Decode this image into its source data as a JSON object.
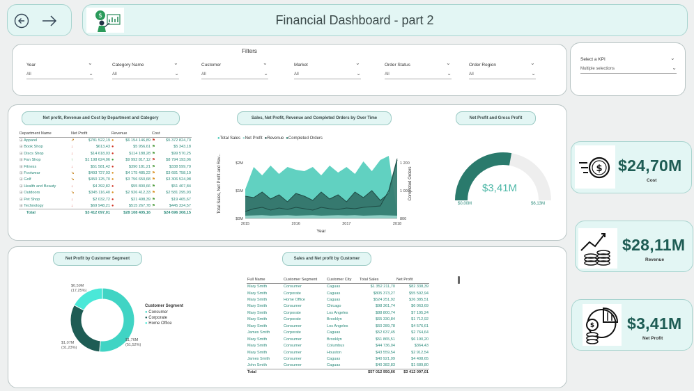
{
  "header": {
    "title": "Financial Dashboard - part 2",
    "back_icon": "arrow-left-icon",
    "forward_icon": "arrow-right-icon",
    "logo_icon": "finance-person-icon"
  },
  "filters": {
    "title": "Filters",
    "items": [
      {
        "label": "Year",
        "value": "All"
      },
      {
        "label": "Category Name",
        "value": "All"
      },
      {
        "label": "Customer",
        "value": "All"
      },
      {
        "label": "Market",
        "value": "All"
      },
      {
        "label": "Order Status",
        "value": "All"
      },
      {
        "label": "Order Region",
        "value": "All"
      }
    ]
  },
  "kpi_selector": {
    "label": "Select a KPI",
    "value": "Multiple selections"
  },
  "dept_table": {
    "title": "Net profit, Revenue and Cost by Department and Category",
    "columns": [
      "Department Name",
      "Net Profit",
      "Revenue",
      "Cost"
    ],
    "rows": [
      {
        "name": "Apparel",
        "net": "$781 522,19",
        "rev": "$6 154 146,89",
        "cost": "$5 372 824,70",
        "ni": "↗",
        "nc": "#c98a2a",
        "ri": "●",
        "rc": "#d89020",
        "ci": "⚑",
        "cc": "#c83a2a"
      },
      {
        "name": "Book Shop",
        "net": "$613,43",
        "rev": "$5 956,61",
        "cost": "$5 343,18",
        "ni": "↓",
        "nc": "#d03020",
        "ri": "●",
        "rc": "#d03020",
        "ci": "⚑",
        "cc": "#4a9a3a"
      },
      {
        "name": "Discs Shop",
        "net": "$14 618,03",
        "rev": "$114 188,28",
        "cost": "$99 570,25",
        "ni": "↓",
        "nc": "#d03020",
        "ri": "●",
        "rc": "#d03020",
        "ci": "⚑",
        "cc": "#4a9a3a"
      },
      {
        "name": "Fan Shop",
        "net": "$1 198 624,06",
        "rev": "$9 992 817,12",
        "cost": "$8 794 193,06",
        "ni": "↑",
        "nc": "#3a9a3a",
        "ri": "●",
        "rc": "#3a9a3a",
        "ci": "⚑",
        "cc": "#c83a2a"
      },
      {
        "name": "Fitness",
        "net": "$51 581,42",
        "rev": "$390 181,21",
        "cost": "$338 599,79",
        "ni": "↓",
        "nc": "#d03020",
        "ri": "●",
        "rc": "#d03020",
        "ci": "⚑",
        "cc": "#4a9a3a"
      },
      {
        "name": "Footwear",
        "net": "$493 727,03",
        "rev": "$4 175 485,22",
        "cost": "$3 681 758,19",
        "ni": "↘",
        "nc": "#c98a2a",
        "ri": "●",
        "rc": "#d89020",
        "ci": "⚑",
        "cc": "#d89020"
      },
      {
        "name": "Golf",
        "net": "$450 125,70",
        "rev": "$3 756 650,68",
        "cost": "$3 306 524,98",
        "ni": "↘",
        "nc": "#c98a2a",
        "ri": "●",
        "rc": "#d89020",
        "ci": "⚑",
        "cc": "#d89020"
      },
      {
        "name": "Health and Beauty",
        "net": "$4 392,82",
        "rev": "$55 800,66",
        "cost": "$51 407,84",
        "ni": "↓",
        "nc": "#d03020",
        "ri": "●",
        "rc": "#d03020",
        "ci": "⚑",
        "cc": "#4a9a3a"
      },
      {
        "name": "Outdoors",
        "net": "$345 116,40",
        "rev": "$2 926 412,33",
        "cost": "$2 581 295,93",
        "ni": "↘",
        "nc": "#c98a2a",
        "ri": "●",
        "rc": "#d89020",
        "ci": "⚑",
        "cc": "#d89020"
      },
      {
        "name": "Pet Shop",
        "net": "$2 032,72",
        "rev": "$21 498,39",
        "cost": "$19 465,67",
        "ni": "↓",
        "nc": "#d03020",
        "ri": "●",
        "rc": "#d03020",
        "ci": "⚑",
        "cc": "#4a9a3a"
      },
      {
        "name": "Technology",
        "net": "$69 948,21",
        "rev": "$515 267,78",
        "cost": "$445 324,57",
        "ni": "↓",
        "nc": "#d03020",
        "ri": "●",
        "rc": "#d03020",
        "ci": "⚑",
        "cc": "#4a9a3a"
      }
    ],
    "total": {
      "name": "Total",
      "net": "$3 412 097,01",
      "rev": "$28 108 405,16",
      "cost": "$24 696 308,15"
    }
  },
  "line_chart": {
    "title": "Sales, Net Profit, Revenue and Completed Orders by Over Time",
    "legend": [
      "Total Sales",
      "Net Profit",
      "Revenue",
      "Completed Orders"
    ],
    "legend_colors": [
      "#45c9b6",
      "#9ad8cf",
      "#1e4a44",
      "#2f7a6c"
    ],
    "xlabel": "Year",
    "ylabel": "Total Sales, Net Profit and Rev...",
    "y2label": "Completed Orders",
    "y_ticks": [
      "$2M",
      "$1M",
      "$0M"
    ],
    "y2_ticks": [
      "1 200",
      "1 000",
      "800"
    ],
    "x_ticks": [
      "2015",
      "2016",
      "2017",
      "2018"
    ]
  },
  "chart_data": [
    {
      "type": "area",
      "title": "Sales, Net Profit, Revenue and Completed Orders by Over Time",
      "xlabel": "Year",
      "ylabel": "Total Sales, Net Profit and Rev...",
      "x": [
        "2015-01",
        "2015-03",
        "2015-05",
        "2015-07",
        "2015-09",
        "2015-11",
        "2016-01",
        "2016-03",
        "2016-05",
        "2016-07",
        "2016-09",
        "2016-11",
        "2017-01",
        "2017-03",
        "2017-05",
        "2017-07",
        "2017-09",
        "2017-11",
        "2018-01"
      ],
      "ylim": [
        0,
        2.5
      ],
      "series": [
        {
          "name": "Total Sales",
          "values": [
            1.05,
            1.85,
            1.55,
            1.9,
            1.6,
            1.85,
            1.75,
            1.7,
            1.85,
            1.55,
            1.9,
            1.65,
            1.85,
            1.6,
            2.05,
            1.7,
            2.1,
            2.25,
            0.15
          ]
        },
        {
          "name": "Revenue",
          "values": [
            0.8,
            0.75,
            0.95,
            0.7,
            0.85,
            0.6,
            0.9,
            0.8,
            0.65,
            0.95,
            0.7,
            0.85,
            0.6,
            0.95,
            0.75,
            1.0,
            0.65,
            0.9,
            2.1
          ]
        },
        {
          "name": "Net Profit",
          "values": [
            0.1,
            0.11,
            0.12,
            0.1,
            0.11,
            0.12,
            0.1,
            0.11,
            0.12,
            0.1,
            0.11,
            0.12,
            0.11,
            0.12,
            0.1,
            0.11,
            0.12,
            0.11,
            0.1
          ]
        },
        {
          "name": "Completed Orders",
          "values": [
            850,
            870,
            880,
            860,
            875,
            865,
            880,
            870,
            860,
            880,
            870,
            865,
            875,
            870,
            880,
            885,
            890,
            1000,
            1230
          ]
        }
      ]
    },
    {
      "type": "pie",
      "title": "Net Profit and Gross Profit",
      "values": [
        3.41
      ],
      "max": 6.13,
      "min": 0,
      "labels": [
        "$3,41M",
        "$0,00M",
        "$6,13M"
      ]
    },
    {
      "type": "pie",
      "title": "Net Profit by Customer Segment",
      "categories": [
        "Consumer",
        "Corporate",
        "Home Office"
      ],
      "values": [
        1.76,
        1.07,
        0.59
      ],
      "labels": [
        "$1,76M\n(51,52%)",
        "$1,07M\n(31,23%)",
        "$0,59M\n(17,25%)"
      ],
      "colors": [
        "#40d4c4",
        "#1e5c54",
        "#4ae8d8"
      ]
    }
  ],
  "gauge": {
    "title": "Net Profit and Gross Profit",
    "value": "$3,41M",
    "min": "$0,00M",
    "max": "$6,13M"
  },
  "donut": {
    "title": "Net Profit by Customer Segment",
    "legend_title": "Customer Segment",
    "legend": [
      "Consumer",
      "Corporate",
      "Home Office"
    ],
    "label_consumer": "$1,76M",
    "pct_consumer": "(51,52%)",
    "label_corporate": "$1,07M",
    "pct_corporate": "(31,23%)",
    "label_home": "$0,59M",
    "pct_home": "(17,25%)"
  },
  "cust_table": {
    "title": "Sales and Net profit by Customer",
    "columns": [
      "Full Name",
      "Customer Segment",
      "Customer City",
      "Total Sales",
      "Net Profit"
    ],
    "rows": [
      [
        "Mary Smith",
        "Consumer",
        "Caguas",
        "$1 352 211,70",
        "$82 338,39"
      ],
      [
        "Mary Smith",
        "Corporate",
        "Caguas",
        "$805 373,27",
        "$55 592,94"
      ],
      [
        "Mary Smith",
        "Home Office",
        "Caguas",
        "$524 251,92",
        "$26 385,51"
      ],
      [
        "Mary Smith",
        "Consumer",
        "Chicago",
        "$98 361,74",
        "$6 063,69"
      ],
      [
        "Mary Smith",
        "Corporate",
        "Los Angeles",
        "$88 800,74",
        "$7 195,24"
      ],
      [
        "Mary Smith",
        "Corporate",
        "Brooklyn",
        "$65 330,84",
        "$1 712,92"
      ],
      [
        "Mary Smith",
        "Consumer",
        "Los Angeles",
        "$60 289,78",
        "$4 576,61"
      ],
      [
        "James Smith",
        "Corporate",
        "Caguas",
        "$52 637,45",
        "$2 764,64"
      ],
      [
        "Mary Smith",
        "Consumer",
        "Brooklyn",
        "$51 865,51",
        "$6 190,20"
      ],
      [
        "Mary Smith",
        "Consumer",
        "Columbus",
        "$44 736,04",
        "$364,43"
      ],
      [
        "Mary Smith",
        "Consumer",
        "Houston",
        "$43 559,54",
        "$2 912,54"
      ],
      [
        "James Smith",
        "Consumer",
        "Caguas",
        "$40 921,09",
        "$4 408,65"
      ],
      [
        "John Smith",
        "Consumer",
        "Caguas",
        "$40 382,83",
        "$1 689,80"
      ]
    ],
    "total": [
      "Total",
      "",
      "",
      "$57 012 950,66",
      "$3 412 097,01"
    ]
  },
  "kpis": [
    {
      "value": "$24,70M",
      "label": "Cost",
      "icon": "dollar-coin-icon"
    },
    {
      "value": "$28,11M",
      "label": "Revenue",
      "icon": "growth-chart-coins-icon"
    },
    {
      "value": "$3,41M",
      "label": "Net Profit",
      "icon": "profit-pie-coins-icon"
    }
  ]
}
